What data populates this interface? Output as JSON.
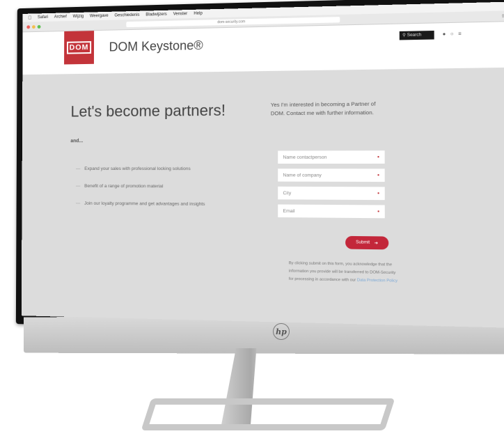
{
  "menubar": {
    "items": [
      "Safari",
      "Archief",
      "Wijzig",
      "Weergave",
      "Geschiedenis",
      "Bladwijzers",
      "Venster",
      "Help"
    ]
  },
  "browser": {
    "url": "dom-security.com"
  },
  "header": {
    "logo_text": "DOM",
    "brand": "DOM Keystone®",
    "search_label": "Search"
  },
  "main": {
    "title": "Let's become partners!",
    "intro": "and...",
    "benefits": [
      "Expand your sales with professional locking solutions",
      "Benefit of a range of promotion material",
      "Join our loyalty programme and get advantages and insights"
    ]
  },
  "form": {
    "intro": "Yes I'm interested in becoming a Partner of DOM. Contact me with further information.",
    "fields": [
      {
        "placeholder": "Name contactperson"
      },
      {
        "placeholder": "Name of company"
      },
      {
        "placeholder": "City"
      },
      {
        "placeholder": "Email"
      }
    ],
    "submit_label": "Submit",
    "disclaimer": "By clicking submit on this form, you acknowledge that the information you provide will be transferred to DOM-Security for processing in accordance with our",
    "disclaimer_link": "Data Protection Policy"
  },
  "hardware": {
    "brand_logo": "hp"
  },
  "colors": {
    "accent": "#c3343a",
    "page_bg": "#dcdcdc",
    "link": "#7aa8d6"
  }
}
